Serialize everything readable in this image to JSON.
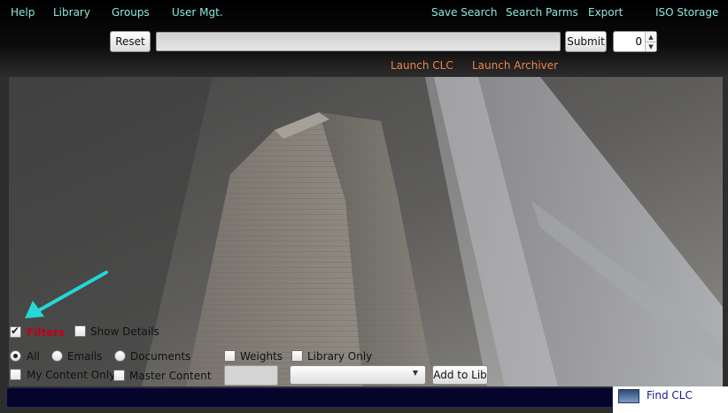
{
  "nav": {
    "help": "Help",
    "library": "Library",
    "groups": "Groups",
    "user_mgt": "User Mgt.",
    "save_search": "Save Search",
    "search_parms": "Search Parms",
    "export": "Export",
    "iso_storage": "ISO Storage"
  },
  "search": {
    "reset_label": "Reset",
    "query_value": "",
    "submit_label": "Submit",
    "count_value": "0"
  },
  "launch": {
    "clc": "Launch CLC",
    "archiver": "Launch Archiver"
  },
  "filters": {
    "filters_label": "Filters",
    "filters_checked": true,
    "show_details_label": "Show Details",
    "all_label": "All",
    "emails_label": "Emails",
    "documents_label": "Documents",
    "weights_label": "Weights",
    "library_only_label": "Library Only",
    "my_content_only_label": "My Content Only",
    "master_content_label": "Master Content",
    "weights_value": "",
    "library_select_value": "",
    "add_to_lib_label": "Add to Lib",
    "selected_scope": "All"
  },
  "footer": {
    "find_clc": "Find CLC"
  },
  "colors": {
    "nav_link": "#8fe6d8",
    "launch_link": "#f0834a",
    "filters_label": "#c0001a",
    "annotation_arrow": "#25d7d7",
    "find_clc": "#1a1a8a",
    "footer_bar": "#05052b"
  },
  "icons": {
    "annotation": "arrow-annotation-icon",
    "find": "find-clc-icon",
    "spinner_up": "spinner-up-icon",
    "spinner_down": "spinner-down-icon",
    "dropdown": "chevron-down-icon"
  }
}
